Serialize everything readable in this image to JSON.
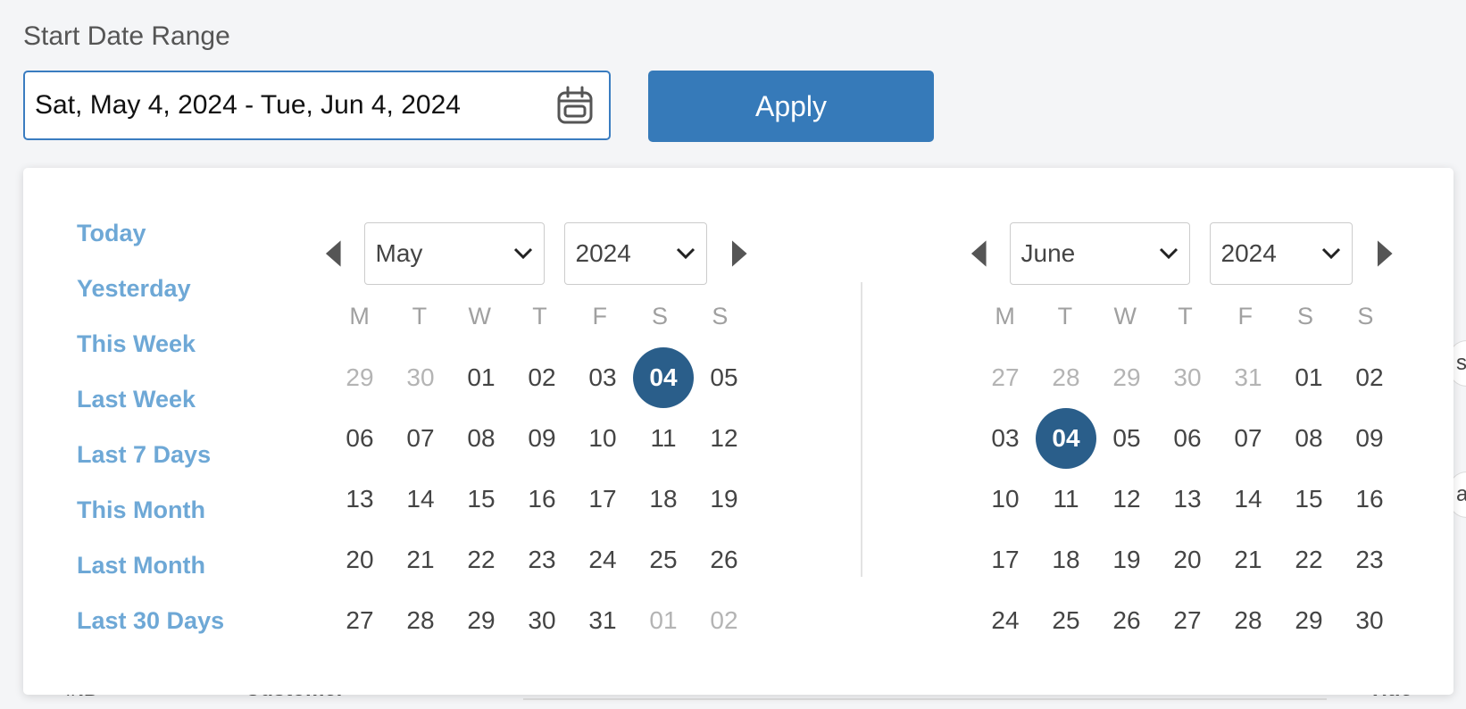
{
  "field_label": "Start Date Range",
  "date_input": {
    "value": "Sat, May 4, 2024 - Tue, Jun 4, 2024",
    "icon": "calendar-icon"
  },
  "apply_button": {
    "label": "Apply",
    "color": "#367ab9"
  },
  "presets": [
    "Today",
    "Yesterday",
    "This Week",
    "Last Week",
    "Last 7 Days",
    "This Month",
    "Last Month",
    "Last 30 Days"
  ],
  "weekdays": [
    "M",
    "T",
    "W",
    "T",
    "F",
    "S",
    "S"
  ],
  "colors": {
    "preset": "#6ea8d6",
    "selected_day": "#2a5e8a",
    "muted_day": "#b4b4b4"
  },
  "calendars": [
    {
      "month": "May",
      "year": "2024",
      "days": [
        {
          "d": "29",
          "muted": true
        },
        {
          "d": "30",
          "muted": true
        },
        {
          "d": "01"
        },
        {
          "d": "02"
        },
        {
          "d": "03"
        },
        {
          "d": "04",
          "selected": true
        },
        {
          "d": "05"
        },
        {
          "d": "06"
        },
        {
          "d": "07"
        },
        {
          "d": "08"
        },
        {
          "d": "09"
        },
        {
          "d": "10"
        },
        {
          "d": "11"
        },
        {
          "d": "12"
        },
        {
          "d": "13"
        },
        {
          "d": "14"
        },
        {
          "d": "15"
        },
        {
          "d": "16"
        },
        {
          "d": "17"
        },
        {
          "d": "18"
        },
        {
          "d": "19"
        },
        {
          "d": "20"
        },
        {
          "d": "21"
        },
        {
          "d": "22"
        },
        {
          "d": "23"
        },
        {
          "d": "24"
        },
        {
          "d": "25"
        },
        {
          "d": "26"
        },
        {
          "d": "27"
        },
        {
          "d": "28"
        },
        {
          "d": "29"
        },
        {
          "d": "30"
        },
        {
          "d": "31"
        },
        {
          "d": "01",
          "muted": true
        },
        {
          "d": "02",
          "muted": true
        }
      ]
    },
    {
      "month": "June",
      "year": "2024",
      "days": [
        {
          "d": "27",
          "muted": true
        },
        {
          "d": "28",
          "muted": true
        },
        {
          "d": "29",
          "muted": true
        },
        {
          "d": "30",
          "muted": true
        },
        {
          "d": "31",
          "muted": true
        },
        {
          "d": "01"
        },
        {
          "d": "02"
        },
        {
          "d": "03"
        },
        {
          "d": "04",
          "selected": true
        },
        {
          "d": "05"
        },
        {
          "d": "06"
        },
        {
          "d": "07"
        },
        {
          "d": "08"
        },
        {
          "d": "09"
        },
        {
          "d": "10"
        },
        {
          "d": "11"
        },
        {
          "d": "12"
        },
        {
          "d": "13"
        },
        {
          "d": "14"
        },
        {
          "d": "15"
        },
        {
          "d": "16"
        },
        {
          "d": "17"
        },
        {
          "d": "18"
        },
        {
          "d": "19"
        },
        {
          "d": "20"
        },
        {
          "d": "21"
        },
        {
          "d": "22"
        },
        {
          "d": "23"
        },
        {
          "d": "24"
        },
        {
          "d": "25"
        },
        {
          "d": "26"
        },
        {
          "d": "27"
        },
        {
          "d": "28"
        },
        {
          "d": "29"
        },
        {
          "d": "30"
        }
      ]
    }
  ],
  "background_table": {
    "headers": [
      "#ID",
      "Customer",
      "Title"
    ],
    "chip_fragments": [
      "s",
      "at"
    ]
  }
}
